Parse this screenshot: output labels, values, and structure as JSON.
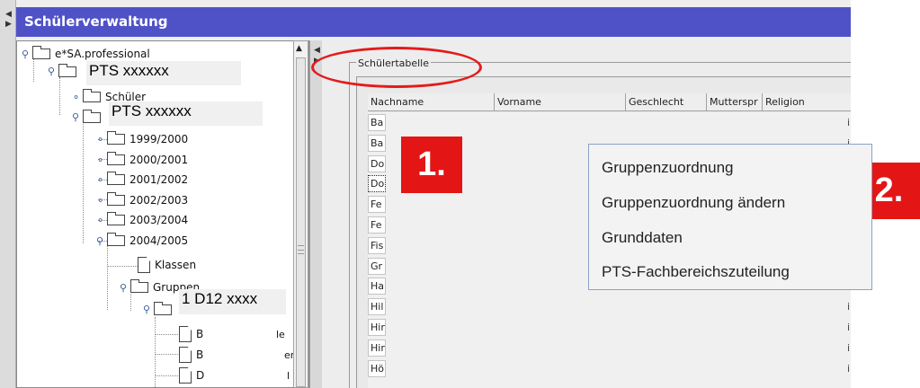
{
  "window": {
    "title": "Schülerverwaltung"
  },
  "tree": {
    "root": "e*SA.professional",
    "school_overlay": "PTS xxxxxx",
    "students": "Schüler",
    "subschool_overlay": "PTS xxxxxx",
    "years": [
      "1999/2000",
      "2000/2001",
      "2001/2002",
      "2002/2003",
      "2003/2004",
      "2004/2005"
    ],
    "classes": "Klassen",
    "groups": "Gruppen",
    "group_overlay": "1 D12 xxxx",
    "group_children": [
      {
        "prefix": "B",
        "suffix": "le"
      },
      {
        "prefix": "B",
        "suffix": "er"
      },
      {
        "prefix": "D",
        "suffix": "l"
      }
    ]
  },
  "students_table": {
    "legend": "Schülertabelle",
    "columns": [
      "Nachname",
      "Vorname",
      "Geschlecht",
      "Mutterspr",
      "Religion"
    ],
    "rows": [
      "Ba",
      "Ba",
      "Do",
      "Do",
      "Fe",
      "Fe",
      "Fis",
      "Gr",
      "Ha",
      "Hil",
      "Hir",
      "Hir",
      "Hö"
    ],
    "selected_row": 3
  },
  "context_menu": {
    "items": [
      "Gruppenzuordnung",
      "Gruppenzuordnung ändern",
      "Grunddaten",
      "PTS-Fachbereichszuteilung"
    ]
  },
  "annotations": {
    "step1": "1.",
    "step2": "2.",
    "highlight_color": "#e41b1b"
  },
  "colors": {
    "titlebar": "#4f52c7",
    "badge": "#e41515"
  }
}
